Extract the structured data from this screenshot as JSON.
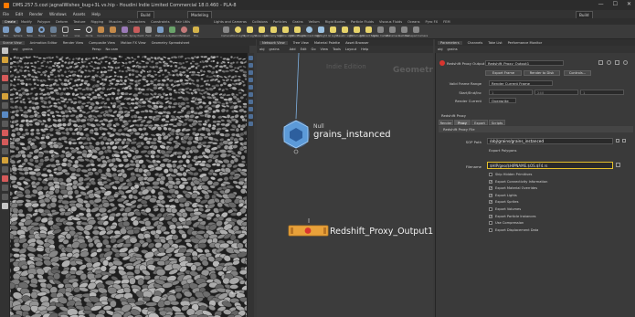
{
  "title_bar": {
    "title": "DMS.257.5.cozi jagnalWishes_bug+3L vs.hip - Houdini Indie Limited Commercial 18.0.460 - PLA-8",
    "window_buttons": [
      "—",
      "☐",
      "✕"
    ]
  },
  "menu_bar": {
    "items": [
      "File",
      "Edit",
      "Render",
      "Windows",
      "Assets",
      "Help"
    ],
    "build_dropdown": "Build",
    "desktop_dropdown": "Modeling",
    "right_dropdown": "Build"
  },
  "shelf": {
    "tabs": [
      "Create",
      "Modify",
      "Polygon",
      "Deform",
      "Texture",
      "Rigging",
      "Muscles",
      "Characters",
      "Constraints",
      "Hair Utils",
      "Guide Process",
      "Guide Brushes",
      "Terrain FX",
      "Cloud FX",
      "Volume"
    ],
    "active_tab": "Create",
    "tools_left": [
      "Box",
      "Sphere",
      "Tube",
      "Torus",
      "Grid",
      "Null",
      "Line",
      "Circle",
      "Curve",
      "Draw Curve",
      "Path",
      "Spray Paint",
      "Font",
      "Platonic",
      "L-System",
      "Metaball",
      "File"
    ],
    "tools_right_tabs": [
      "Lights and Cameras",
      "Collisions",
      "Particles",
      "Grains",
      "Vellum",
      "Rigid Bodies",
      "Particle Fluids",
      "Viscous Fluids",
      "Oceans",
      "Pyro FX",
      "FEM",
      "Wires",
      "Crowds",
      "Drive Simulation"
    ],
    "tools_right": [
      "Camera",
      "Point Light",
      "Spot Light",
      "Area Light",
      "Geometry Light",
      "Volume Light",
      "Distant Light",
      "Environment Light",
      "Sky Light",
      "GI Light",
      "Caustic Light",
      "Portal Light",
      "Ambient Light",
      "Stereo Camera",
      "VR Camera",
      "Switcher",
      "Gamepad Camera"
    ]
  },
  "viewport_pane": {
    "tabs": [
      "Scene View",
      "Animation Editor",
      "Render View",
      "Composite View",
      "Motion FX View",
      "Geometry Spreadsheet"
    ],
    "path": "obj",
    "path_sub": "grains",
    "view_label": "Persp",
    "cam_label": "No cam",
    "corner_note": "4.8k"
  },
  "network_pane": {
    "tabs": [
      "Network View",
      "Tree View",
      "Material Palette",
      "Asset Browser"
    ],
    "path": "obj",
    "path_sub": "grains",
    "menu": [
      "Add",
      "Edit",
      "Go",
      "View",
      "Tools",
      "Layout",
      "Help"
    ],
    "context_label_1": "Indie Edition",
    "context_label_2": "Geometry",
    "nodes": [
      {
        "type": "Null",
        "name": "grains_instanced",
        "color": "#4a8fd4"
      },
      {
        "type": "Redshift Proxy Output",
        "name": "Redshift_Proxy_Output1",
        "color": "#e8a13a"
      }
    ]
  },
  "parameter_pane": {
    "tabs": [
      "Parameters",
      "Channels",
      "Take List",
      "Performance Monitor"
    ],
    "path": "obj",
    "path_sub": "grains",
    "node_type": "Redshift Proxy Output",
    "node_name": "Redshift_Proxy_Output1",
    "buttons": [
      "Export Frame",
      "Render to Disk",
      "Controls..."
    ],
    "render_range_label": "Valid Frame Range",
    "render_range_value": "Render Current Frame",
    "start_end_label": "Start/End/Inc",
    "start_values": [
      "1",
      "240",
      "1"
    ],
    "moveselect_label": "Render Current",
    "moveselect_value": "Overwrite",
    "section_title": "Redshift Proxy",
    "section_tabs": [
      "Render",
      "Proxy",
      "Export",
      "Scripts"
    ],
    "active_section_tab": "Proxy",
    "subsection_title": "Redshift Proxy File",
    "file_label": "SOP Path",
    "file_value": "/obj/grains/grains_instanced",
    "export_label": "Export Polygons",
    "filename_label": "Filename",
    "filename_value": "$HIP/geo/$HIPNAME.$OS.$F4.rs",
    "checks": [
      {
        "label": "Skip Hidden Primitives",
        "checked": false
      },
      {
        "label": "Export Connectivity Information",
        "checked": true
      },
      {
        "label": "Export Material Overrides",
        "checked": true
      },
      {
        "label": "Export Lights",
        "checked": true
      },
      {
        "label": "Export Sprites",
        "checked": true
      },
      {
        "label": "Export Volumes",
        "checked": false
      },
      {
        "label": "Export Particle Instances",
        "checked": true
      },
      {
        "label": "Use Compression",
        "checked": false
      },
      {
        "label": "Export Displacement Data",
        "checked": false
      }
    ],
    "accent_color": "#e5c02a"
  }
}
